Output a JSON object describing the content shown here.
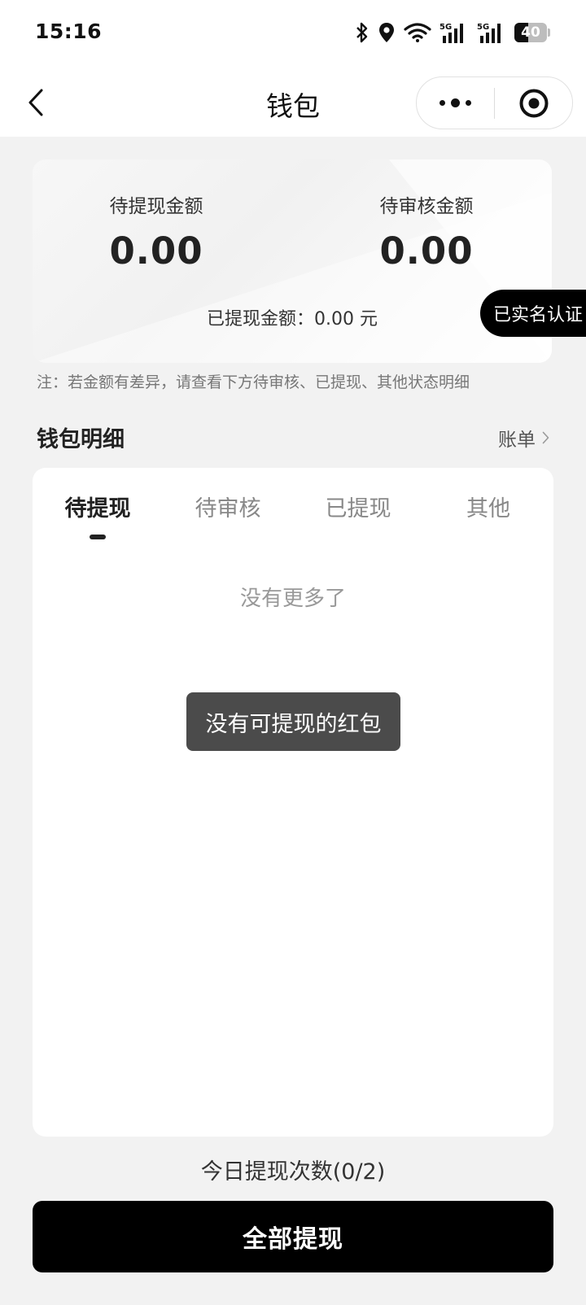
{
  "status_bar": {
    "time": "15:16",
    "battery": "40",
    "icons": [
      "bluetooth-icon",
      "location-icon",
      "wifi-icon",
      "signal-5g-icon",
      "signal-5g-icon",
      "battery-icon"
    ]
  },
  "nav": {
    "title": "钱包",
    "back_icon": "chevron-left-icon",
    "more_icon": "more-dots-icon",
    "close_icon": "target-circle-icon"
  },
  "summary": {
    "pending_withdraw_label": "待提现金额",
    "pending_withdraw_value": "0.00",
    "pending_review_label": "待审核金额",
    "pending_review_value": "0.00",
    "withdrawn_text": "已提现金额：0.00 元"
  },
  "verify_badge": "已实名认证",
  "note": "注：若金额有差异，请查看下方待审核、已提现、其他状态明细",
  "details": {
    "title": "钱包明细",
    "bill_link": "账单",
    "tabs": [
      {
        "label": "待提现",
        "active": true
      },
      {
        "label": "待审核",
        "active": false
      },
      {
        "label": "已提现",
        "active": false
      },
      {
        "label": "其他",
        "active": false
      }
    ],
    "empty_text": "没有更多了"
  },
  "toast": "没有可提现的红包",
  "withdraw_count": "今日提现次数(0/2)",
  "withdraw_button": "全部提现",
  "colors": {
    "background": "#f2f2f2",
    "primary_button": "#000000",
    "toast": "#3c3c3c"
  }
}
